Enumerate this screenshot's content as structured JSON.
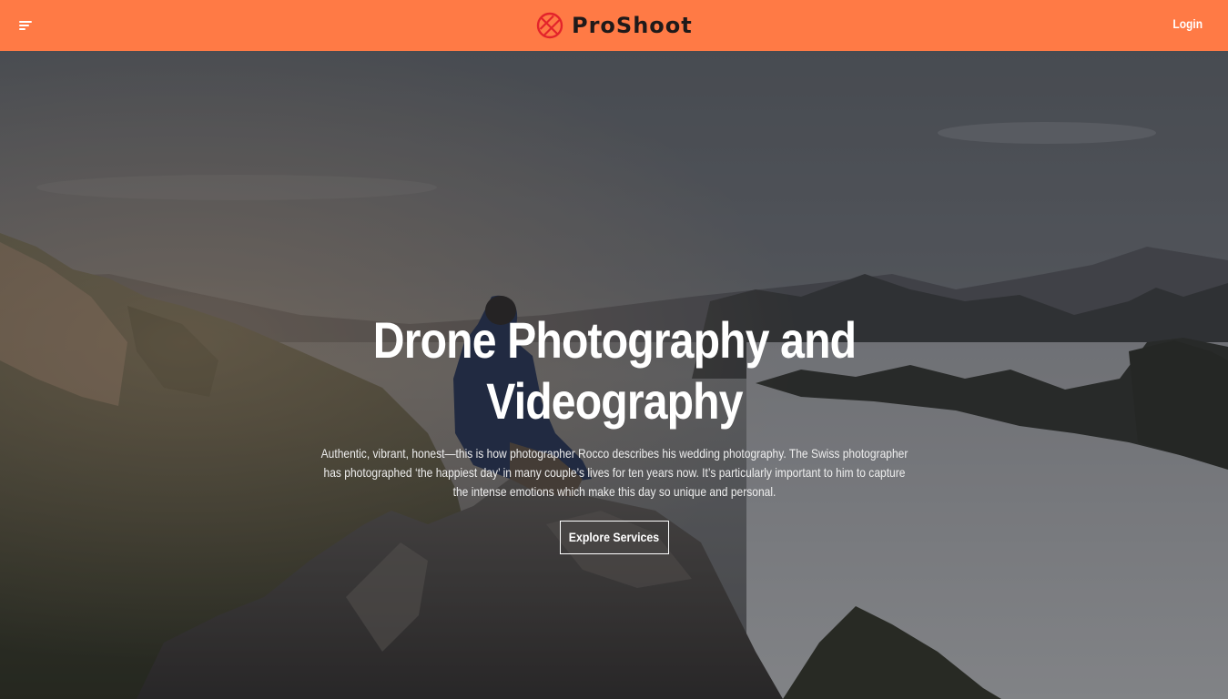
{
  "header": {
    "background_color": "#ff7a45",
    "menu_icon": "menu-icon",
    "brand": {
      "icon": "aperture-logo-icon",
      "name": "ProShoot",
      "icon_color": "#e3232b"
    },
    "login_label": "Login"
  },
  "hero": {
    "background_image": "hiker-on-rocky-summit-above-misty-mountain-valley",
    "title": "Drone Photography and Videography",
    "description": "Authentic, vibrant, honest—this is how photographer Rocco describes his wedding photography. The Swiss photographer has photographed ‘the happiest day’ in many couple’s lives for ten years now. It’s particularly important to him to capture the intense emotions which make this day so unique and personal.",
    "cta_label": "Explore Services"
  }
}
